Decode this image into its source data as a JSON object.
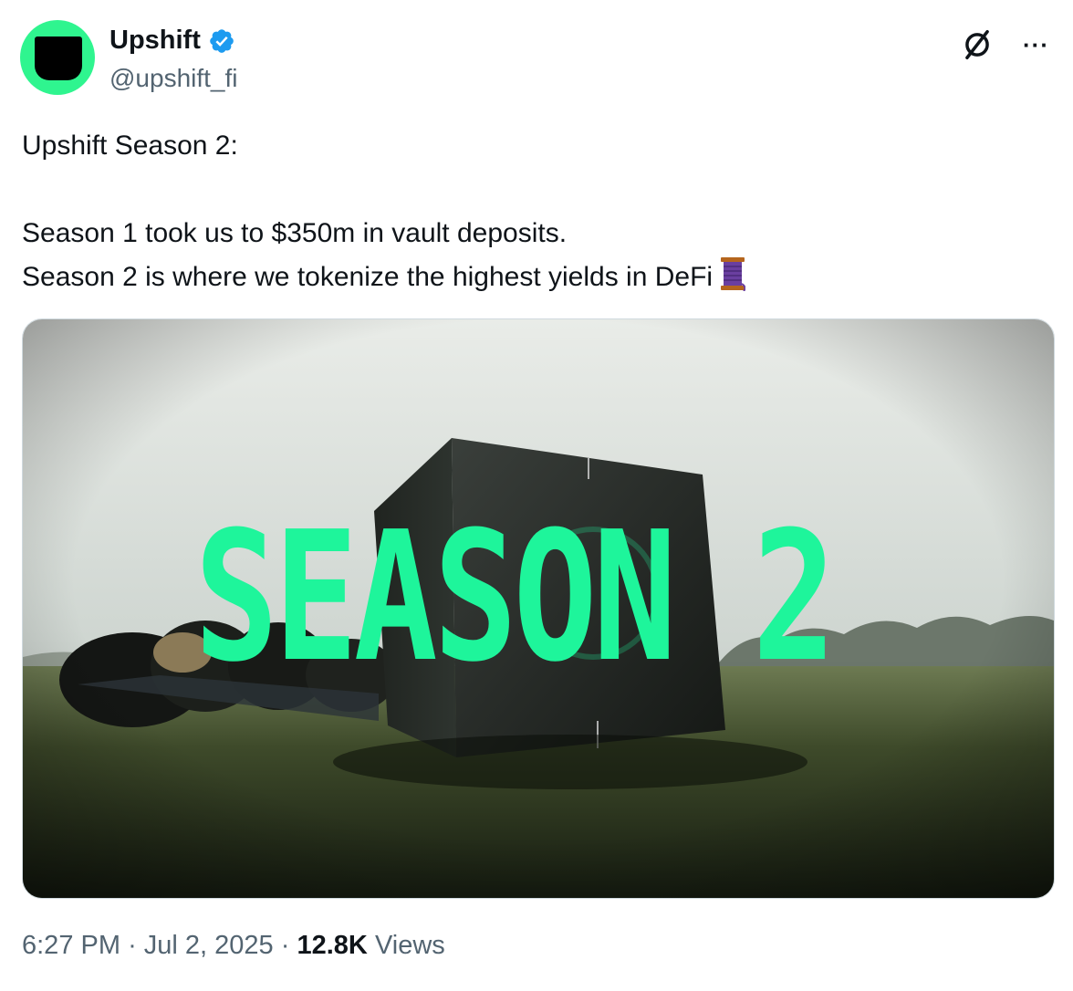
{
  "author": {
    "name": "Upshift",
    "handle": "@upshift_fi",
    "verified": true,
    "avatar_color": "#2ff58f"
  },
  "tweet": {
    "lines": [
      "Upshift Season 2:",
      "Season 1 took us to $350m in vault deposits.",
      "Season 2 is where we tokenize the highest yields in DeFi"
    ],
    "emoji_icon": "thread-spool-icon"
  },
  "media": {
    "overlay_text": "SEASON 2",
    "overlay_color": "#1ef59b"
  },
  "meta": {
    "time": "6:27 PM",
    "separator": "·",
    "date": "Jul 2, 2025",
    "views_count": "12.8K",
    "views_label": "Views"
  },
  "icons": {
    "verified": "verified-badge-icon",
    "link": "link-icon",
    "more": "more-icon"
  }
}
